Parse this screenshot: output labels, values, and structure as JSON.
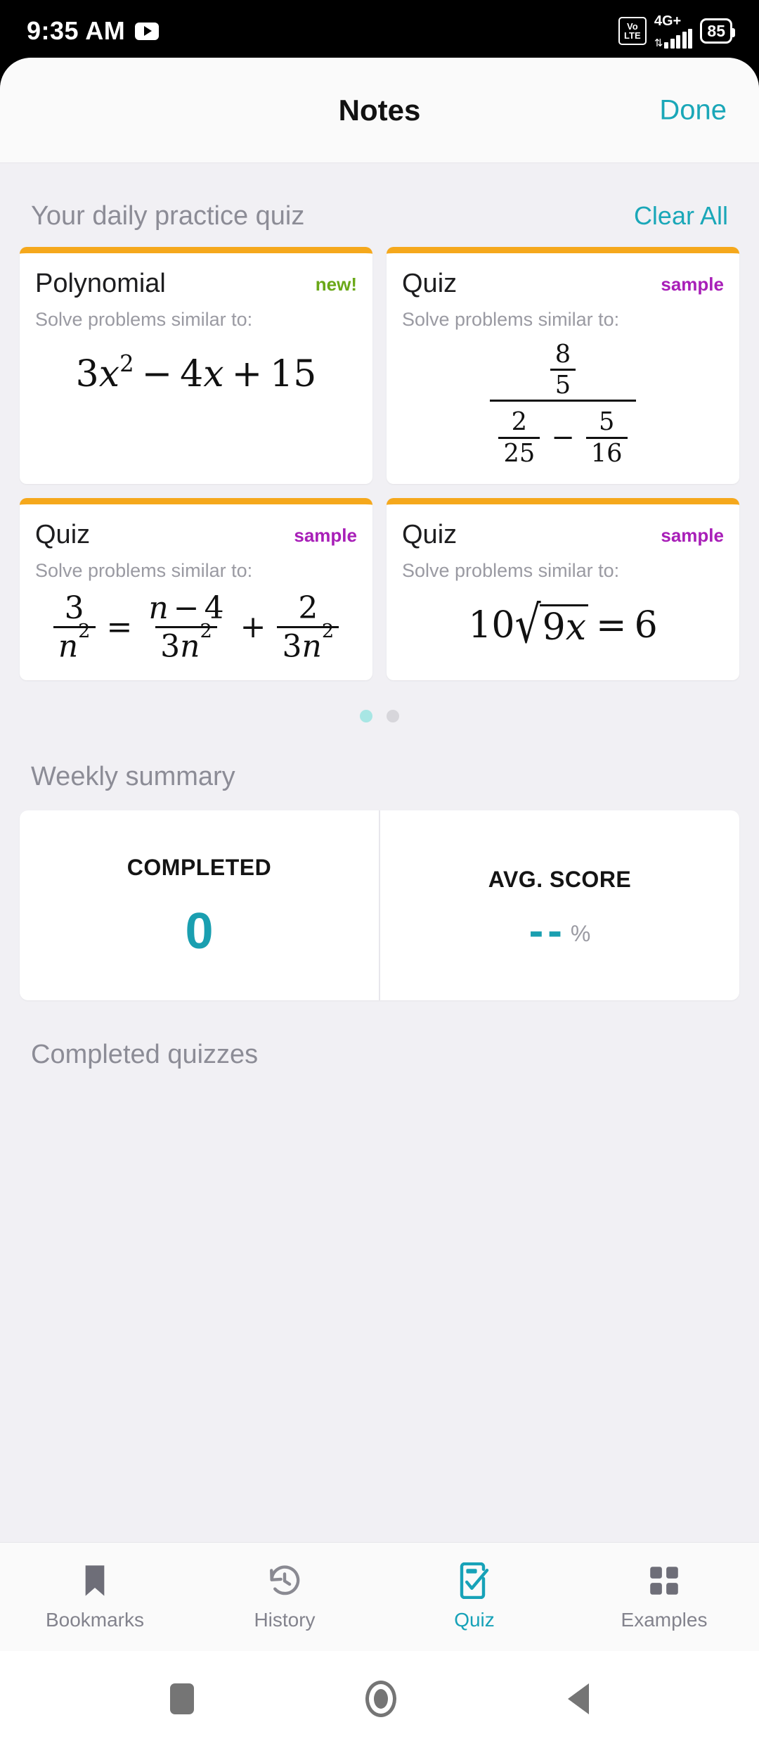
{
  "statusbar": {
    "time": "9:35 AM",
    "media_icon": "youtube-play-icon",
    "volte_top": "Vo",
    "volte_bottom": "LTE",
    "network": "4G+",
    "battery": "85"
  },
  "header": {
    "title": "Notes",
    "done_label": "Done"
  },
  "daily": {
    "section_title": "Your daily practice quiz",
    "clear_all_label": "Clear All",
    "subtitle": "Solve problems similar to:",
    "cards": [
      {
        "title": "Polynomial",
        "badge": "new!",
        "badge_kind": "new",
        "expression": "3x^2 - 4x + 15"
      },
      {
        "title": "Quiz",
        "badge": "sample",
        "badge_kind": "sample",
        "expression": "(8/5) / (2/25 - 5/16)"
      },
      {
        "title": "Quiz",
        "badge": "sample",
        "badge_kind": "sample",
        "expression": "3/n^2 = (n-4)/(3n^2) + 2/(3n^2)"
      },
      {
        "title": "Quiz",
        "badge": "sample",
        "badge_kind": "sample",
        "expression": "10*sqrt(9x) = 6"
      }
    ],
    "pager": {
      "count": 2,
      "active_index": 0
    }
  },
  "weekly": {
    "section_title": "Weekly summary",
    "stats": [
      {
        "label": "COMPLETED",
        "value": "0",
        "suffix": ""
      },
      {
        "label": "AVG. SCORE",
        "value": "--",
        "suffix": "%"
      }
    ]
  },
  "completed": {
    "section_title": "Completed quizzes",
    "items": []
  },
  "bottom_nav": {
    "items": [
      {
        "label": "Bookmarks",
        "icon": "bookmark-icon",
        "active": false
      },
      {
        "label": "History",
        "icon": "clock-rotate-icon",
        "active": false
      },
      {
        "label": "Quiz",
        "icon": "checklist-icon",
        "active": true
      },
      {
        "label": "Examples",
        "icon": "grid-icon",
        "active": false
      }
    ]
  },
  "system_nav": {
    "recents": "square-recents-icon",
    "home": "circle-home-icon",
    "back": "triangle-back-icon"
  },
  "colors": {
    "accent_teal": "#17a2b8",
    "card_top_orange": "#f5a81c",
    "badge_new_green": "#6aa818",
    "badge_sample_purple": "#a81fb8",
    "muted_gray": "#8c8c96",
    "page_bg": "#f1f0f4"
  }
}
